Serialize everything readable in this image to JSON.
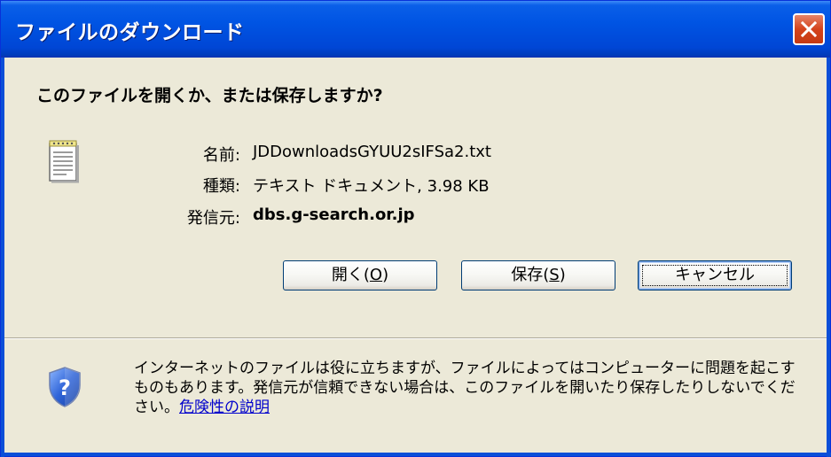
{
  "window": {
    "title": "ファイルのダウンロード"
  },
  "dialog": {
    "question": "このファイルを開くか、または保存しますか?",
    "file_icon": "text-document-icon",
    "info": {
      "name_label": "名前:",
      "name_value": "JDDownloadsGYUU2sIFSa2.txt",
      "type_label": "種類:",
      "type_value": "テキスト ドキュメント, 3.98 KB",
      "from_label": "発信元:",
      "from_value": "dbs.g-search.or.jp"
    },
    "buttons": {
      "open_label": "開く(",
      "open_key": "O",
      "open_suffix": ")",
      "save_label": "保存(",
      "save_key": "S",
      "save_suffix": ")",
      "cancel_label": "キャンセル"
    },
    "warning": {
      "icon": "security-shield-icon",
      "text": "インターネットのファイルは役に立ちますが、ファイルによってはコンピューターに問題を起こすものもあります。発信元が信頼できない場合は、このファイルを開いたり保存したりしないでください。",
      "link_text": "危険性の説明"
    }
  },
  "colors": {
    "titlebar": "#0054e3",
    "dialog_bg": "#ece9d8",
    "close_button": "#d4431c",
    "link": "#0000cc",
    "button_border": "#003c74"
  }
}
